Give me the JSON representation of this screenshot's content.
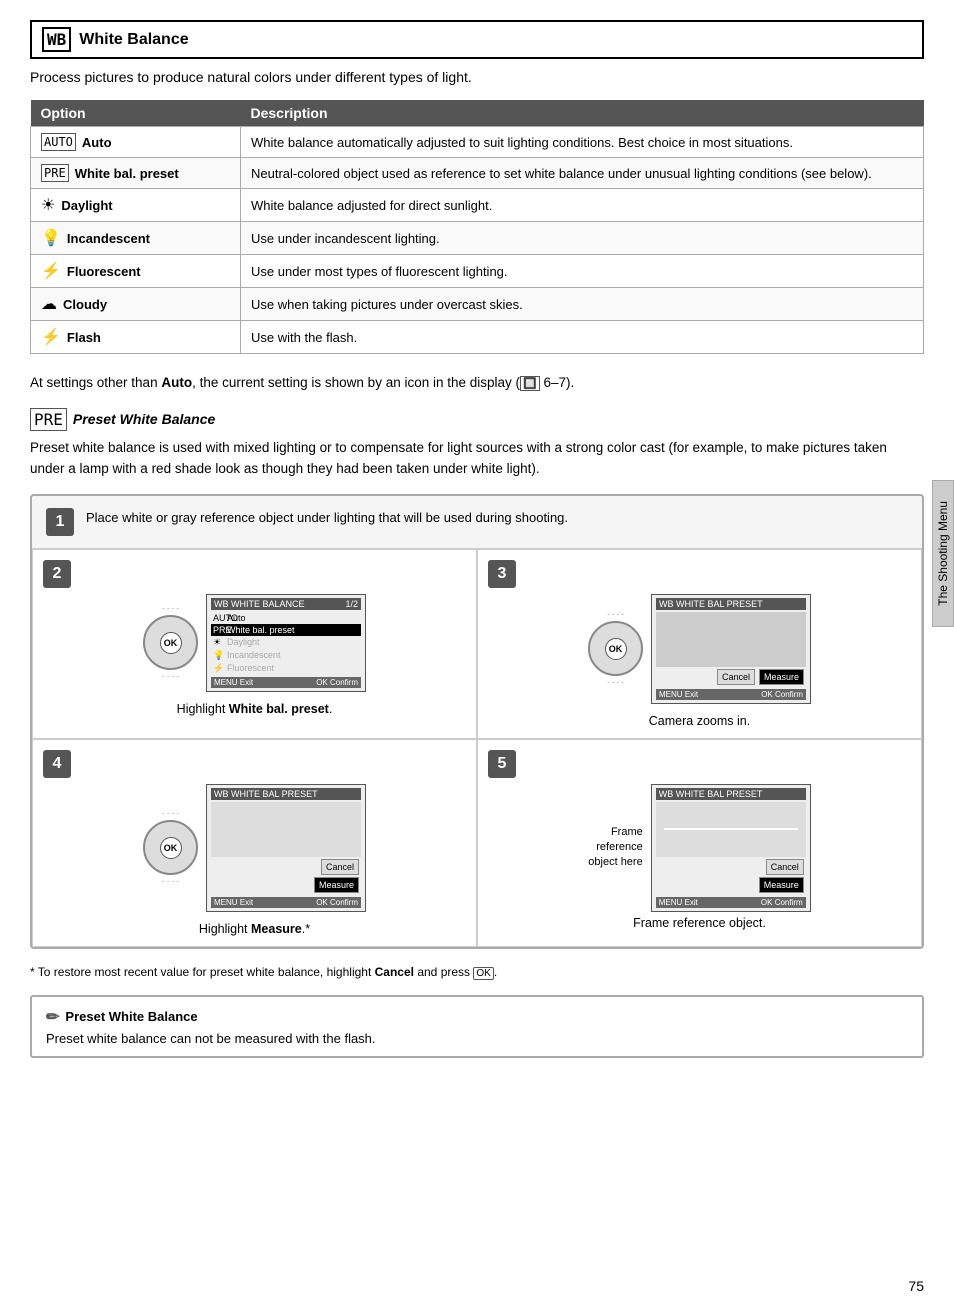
{
  "header": {
    "icon": "WB",
    "title": "White Balance"
  },
  "subtitle": "Process pictures to produce natural colors under different types of light.",
  "table": {
    "col1": "Option",
    "col2": "Description",
    "rows": [
      {
        "icon": "🔳",
        "icon_text": "AUTO",
        "name": "Auto",
        "description": "White balance automatically adjusted to suit lighting conditions. Best choice in most situations."
      },
      {
        "icon": "PRE",
        "name": "White bal. preset",
        "description": "Neutral-colored object used as reference to set white balance under unusual lighting conditions (see below)."
      },
      {
        "icon": "☀",
        "name": "Daylight",
        "description": "White balance adjusted for direct sunlight."
      },
      {
        "icon": "💡",
        "name": "Incandescent",
        "description": "Use under incandescent lighting."
      },
      {
        "icon": "⚡",
        "name": "Fluorescent",
        "description": "Use under most types of fluorescent lighting."
      },
      {
        "icon": "☁",
        "name": "Cloudy",
        "description": "Use when taking pictures under overcast skies."
      },
      {
        "icon": "⚡",
        "name": "Flash",
        "description": "Use with the flash."
      }
    ]
  },
  "body_para": "At settings other than Auto, the current setting is shown by an icon in the display (🔲 6–7).",
  "preset_section": {
    "subtitle": "Preset White Balance",
    "para": "Preset white balance is used with mixed lighting or to compensate for light sources with a strong color cast (for example, to make pictures taken under a lamp with a red shade look as though they had been taken under white light)."
  },
  "steps": [
    {
      "num": "1",
      "text": "Place white or gray reference object under lighting that will be used during shooting."
    },
    {
      "num": "2",
      "caption": "Highlight White bal. preset."
    },
    {
      "num": "3",
      "caption": "Camera zooms in."
    },
    {
      "num": "4",
      "caption": "Highlight Measure."
    },
    {
      "num": "5",
      "caption": "Frame reference object."
    }
  ],
  "footnote": "* To restore most recent value for preset white balance, highlight Cancel and press OK.",
  "note": {
    "title": "Preset White Balance",
    "text": "Preset white balance can not be measured with the flash."
  },
  "lcd_screens": {
    "step2": {
      "title": "WHITE BALANCE",
      "page": "1/2",
      "rows": [
        "Auto",
        "White bal. preset",
        "Daylight",
        "Incandescent",
        "Fluorescent"
      ],
      "selected": 1,
      "footer_left": "MENU Exit",
      "footer_right": "OK Confirm"
    },
    "step3_4_5": {
      "title": "WHITE BAL PRESET",
      "items": [
        "Cancel",
        "Measure"
      ],
      "footer_left": "MENU Exit",
      "footer_right": "OK Confirm"
    }
  },
  "page_number": "75",
  "side_tab": "The Shooting Menu"
}
